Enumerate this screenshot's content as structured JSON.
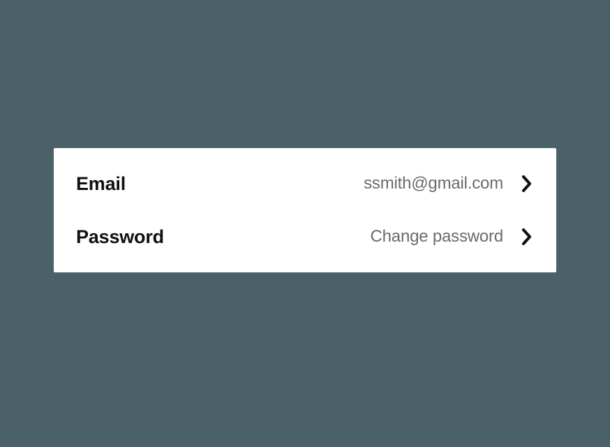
{
  "settings": {
    "rows": [
      {
        "label": "Email",
        "value": "ssmith@gmail.com"
      },
      {
        "label": "Password",
        "value": "Change password"
      }
    ]
  }
}
